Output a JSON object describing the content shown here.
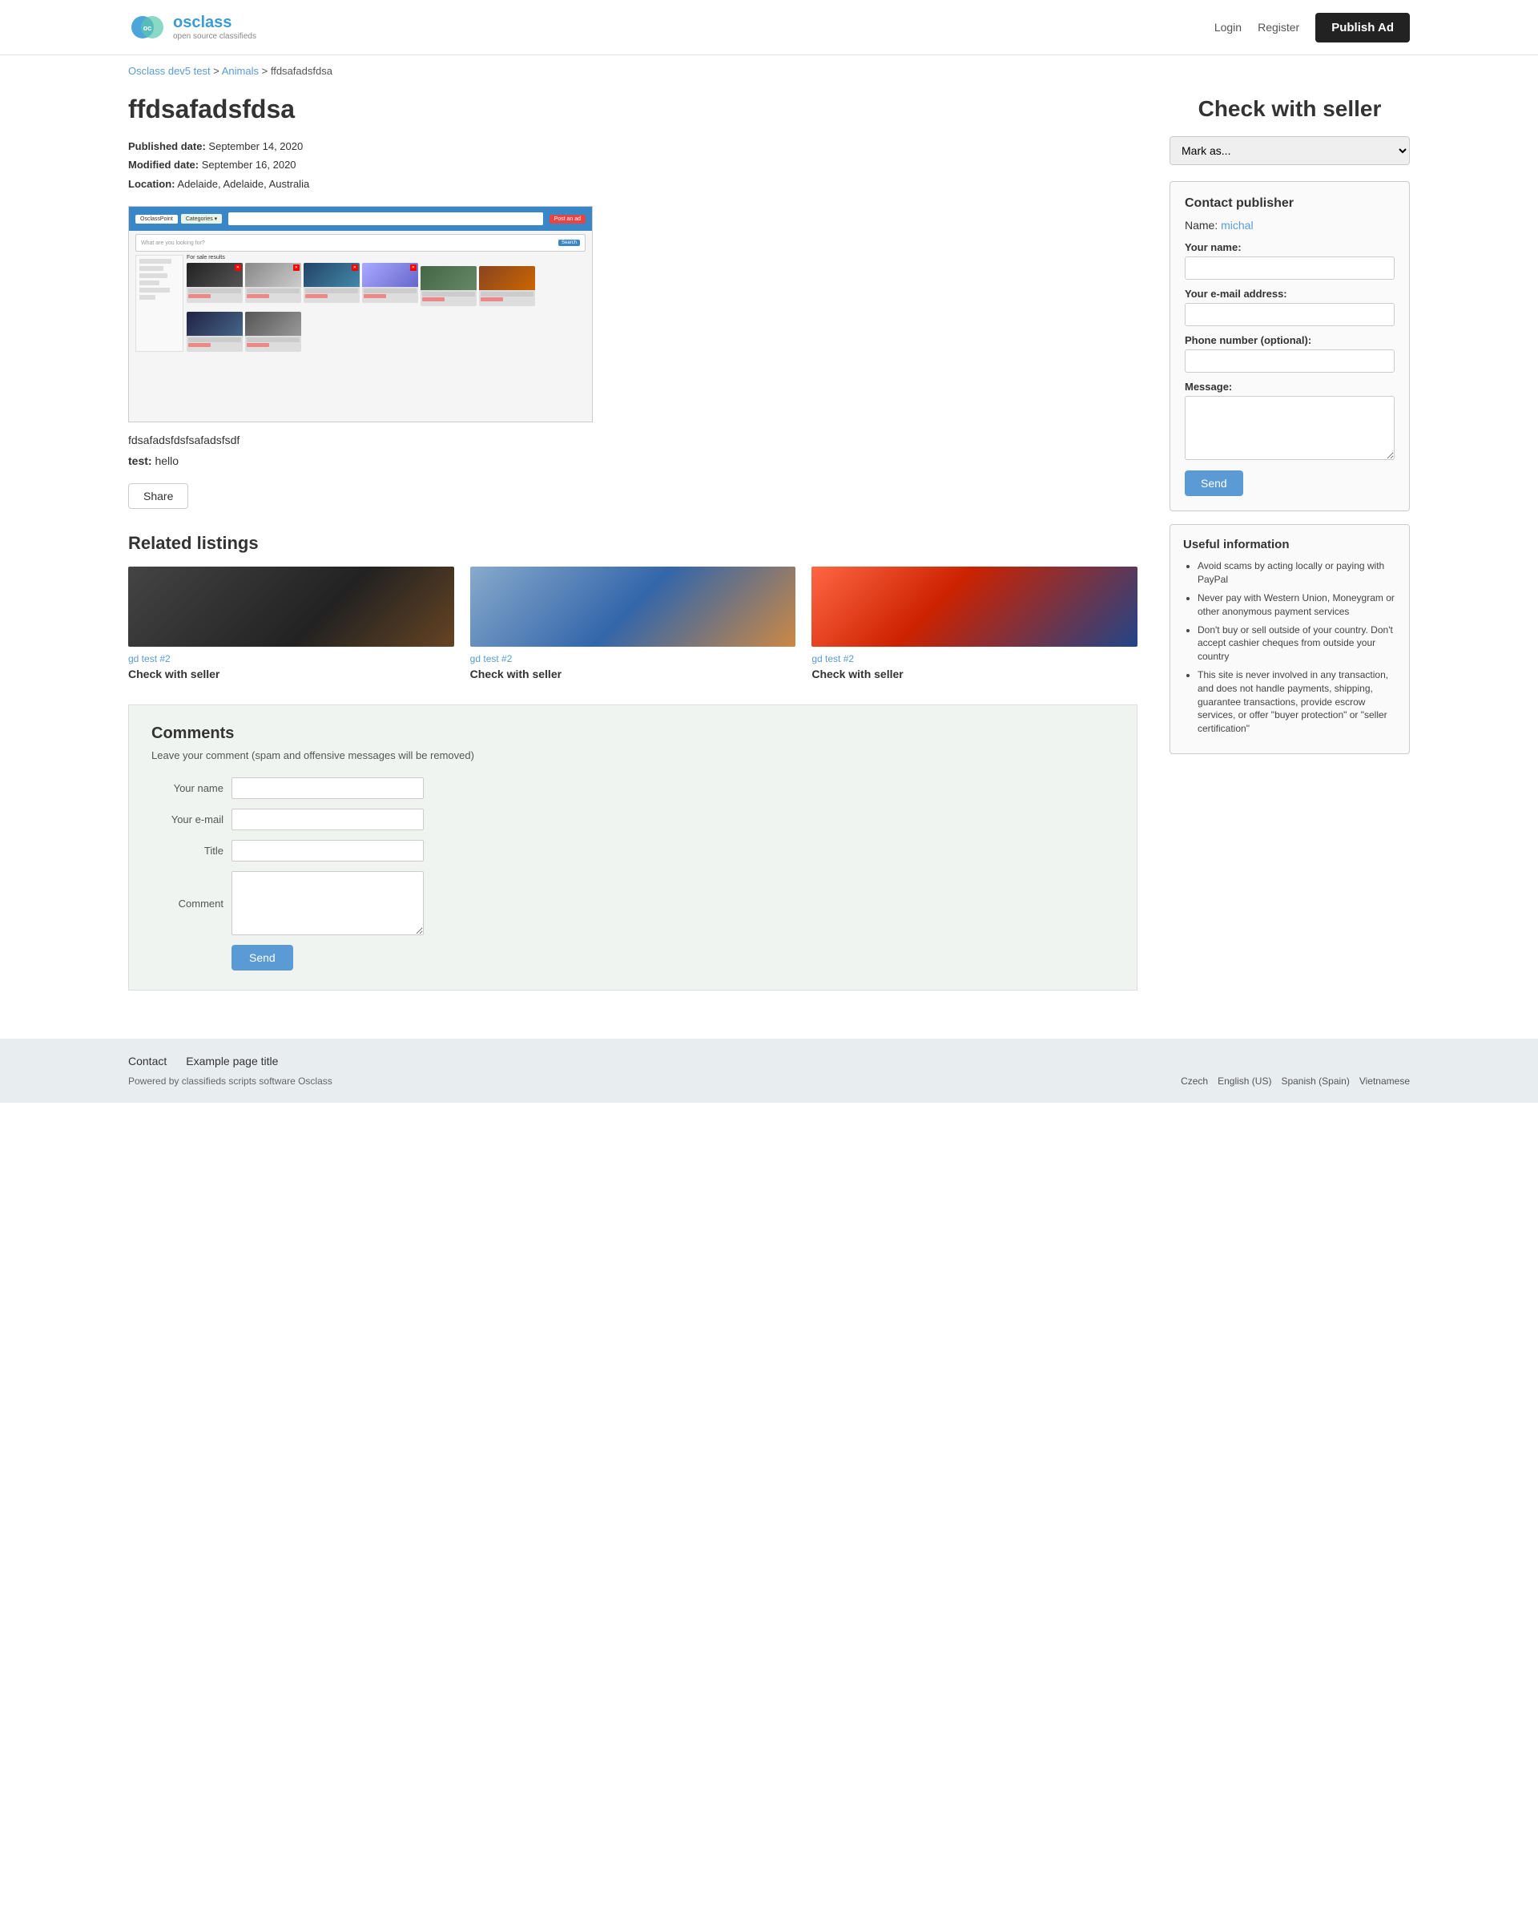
{
  "header": {
    "logo_text": "osclass",
    "logo_subtitle": "open source classifieds",
    "nav": {
      "login": "Login",
      "register": "Register",
      "publish_ad": "Publish Ad"
    }
  },
  "breadcrumb": {
    "home": "Osclass dev5 test",
    "category": "Animals",
    "current": "ffdsafadsfdsa"
  },
  "ad": {
    "title": "ffdsafadsfdsa",
    "published_label": "Published date:",
    "published_date": "September 14, 2020",
    "modified_label": "Modified date:",
    "modified_date": "September 16, 2020",
    "location_label": "Location:",
    "location": "Adelaide, Adelaide, Australia",
    "description": "fdsafadsfdsfsafadsfsdf",
    "test_label": "test:",
    "test_value": "hello",
    "share_button": "Share"
  },
  "right_column": {
    "check_with_seller": "Check with seller",
    "mark_as_placeholder": "Mark as...",
    "contact_publisher": {
      "title": "Contact publisher",
      "name_label": "Name:",
      "name_value": "michal",
      "your_name_label": "Your name:",
      "email_label": "Your e-mail address:",
      "phone_label": "Phone number (optional):",
      "message_label": "Message:",
      "send_button": "Send"
    },
    "useful_info": {
      "title": "Useful information",
      "items": [
        "Avoid scams by acting locally or paying with PayPal",
        "Never pay with Western Union, Moneygram or other anonymous payment services",
        "Don't buy or sell outside of your country. Don't accept cashier cheques from outside your country",
        "This site is never involved in any transaction, and does not handle payments, shipping, guarantee transactions, provide escrow services, or offer \"buyer protection\" or \"seller certification\""
      ]
    }
  },
  "related_listings": {
    "title": "Related listings",
    "cards": [
      {
        "category": "gd test #2",
        "price": "Check with seller"
      },
      {
        "category": "gd test #2",
        "price": "Check with seller"
      },
      {
        "category": "gd test #2",
        "price": "Check with seller"
      }
    ]
  },
  "comments": {
    "title": "Comments",
    "subtitle": "Leave your comment (spam and offensive messages will be removed)",
    "your_name_label": "Your name",
    "your_email_label": "Your e-mail",
    "title_label": "Title",
    "comment_label": "Comment",
    "send_button": "Send"
  },
  "footer": {
    "links": [
      {
        "label": "Contact"
      },
      {
        "label": "Example page title"
      }
    ],
    "powered_text": "Powered by classifieds scripts software Osclass",
    "languages": [
      "Czech",
      "English (US)",
      "Spanish (Spain)",
      "Vietnamese"
    ]
  }
}
